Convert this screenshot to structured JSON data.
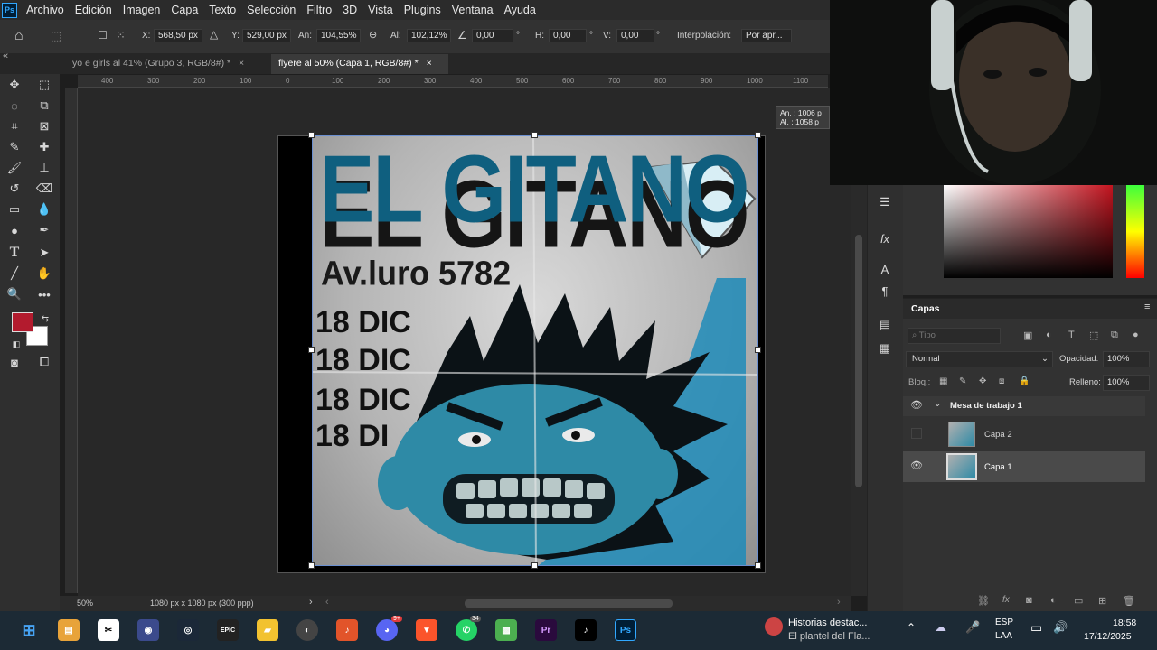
{
  "app": {
    "logo": "Ps",
    "menu": [
      "Archivo",
      "Edición",
      "Imagen",
      "Capa",
      "Texto",
      "Selección",
      "Filtro",
      "3D",
      "Vista",
      "Plugins",
      "Ventana",
      "Ayuda"
    ]
  },
  "options": {
    "x_label": "X:",
    "x_value": "568,50 px",
    "y_label": "Y:",
    "y_value": "529,00 px",
    "w_label": "An:",
    "w_value": "104,55%",
    "h_label": "Al:",
    "h_value": "102,12%",
    "angle_value": "0,00",
    "deg": "°",
    "hskew_label": "H:",
    "hskew_value": "0,00",
    "vskew_label": "V:",
    "vskew_value": "0,00",
    "interp_label": "Interpolación:",
    "interp_value": "Por apr..."
  },
  "tabs": [
    {
      "label": "yo e girls al 41% (Grupo 3, RGB/8#) *",
      "active": false
    },
    {
      "label": "flyere al 50% (Capa 1, RGB/8#) *",
      "active": true
    }
  ],
  "ruler": {
    "ticks": [
      "400",
      "300",
      "200",
      "100",
      "0",
      "100",
      "200",
      "300",
      "400",
      "500",
      "600",
      "700",
      "800",
      "900",
      "1000",
      "1100"
    ]
  },
  "transform_tooltip": {
    "w_label": "An. :",
    "w_value": "1006 p",
    "h_label": "Al. :",
    "h_value": "1058 p"
  },
  "flyer": {
    "title": "EL GITANO",
    "address": "Av.luro 5782",
    "dates": [
      "18 DIC",
      "18 DIC",
      "18 DIC",
      "18 DI"
    ]
  },
  "status": {
    "zoom": "50%",
    "doc_info": "1080 px x 1080 px (300 ppp)"
  },
  "colors": {
    "foreground": "#b31b2e",
    "background": "#ffffff",
    "title_blue": "#0f5f7f"
  },
  "layers": {
    "panel_title": "Capas",
    "search_placeholder": "Tipo",
    "blend_mode": "Normal",
    "opacity_label": "Opacidad:",
    "opacity_value": "100%",
    "lock_label": "Bloq.:",
    "fill_label": "Relleno:",
    "fill_value": "100%",
    "group_name": "Mesa de trabajo 1",
    "items": [
      {
        "name": "Capa 2",
        "visible": false,
        "selected": false
      },
      {
        "name": "Capa 1",
        "visible": true,
        "selected": true
      }
    ]
  },
  "taskbar": {
    "notification_title": "Historias destac...",
    "notification_subtitle": "El plantel del Fla...",
    "lang_top": "ESP",
    "lang_bottom": "LAA",
    "time": "18:58",
    "date": "17/12/2025",
    "whatsapp_badge": "34",
    "discord_badge": "9+"
  }
}
